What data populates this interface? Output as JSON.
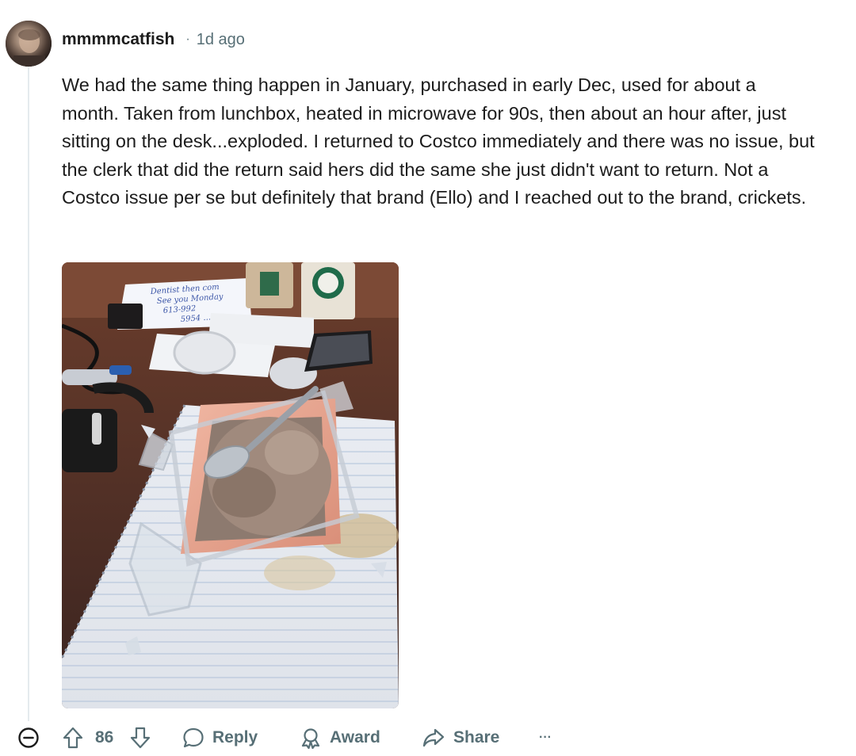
{
  "comment": {
    "author": "mmmmcatfish",
    "separator": "·",
    "age": "1d ago",
    "body": "We had the same thing happen in January, purchased in early Dec, used for about a month. Taken from lunchbox, heated in microwave for 90s, then about an hour after, just sitting on the desk...exploded. I returned to Costco immediately and there was no issue, but the clerk that did the return said hers did the same she just didn't want to return. Not a Costco issue per se but definitely that brand (Ello) and I reached out to the brand, crickets.",
    "image": {
      "icon": "photo-of-shattered-glass-food-container",
      "note_lines": [
        "Dentist then com",
        "See you Monday",
        "613-992",
        "5954 ..."
      ]
    }
  },
  "actions": {
    "collapse_icon": "minus-circle-icon",
    "score": "86",
    "reply_label": "Reply",
    "award_label": "Award",
    "share_label": "Share",
    "more_label": "···"
  },
  "colors": {
    "muted": "#576f76",
    "text": "#1c1c1c",
    "thread_line": "#e5ebee"
  }
}
